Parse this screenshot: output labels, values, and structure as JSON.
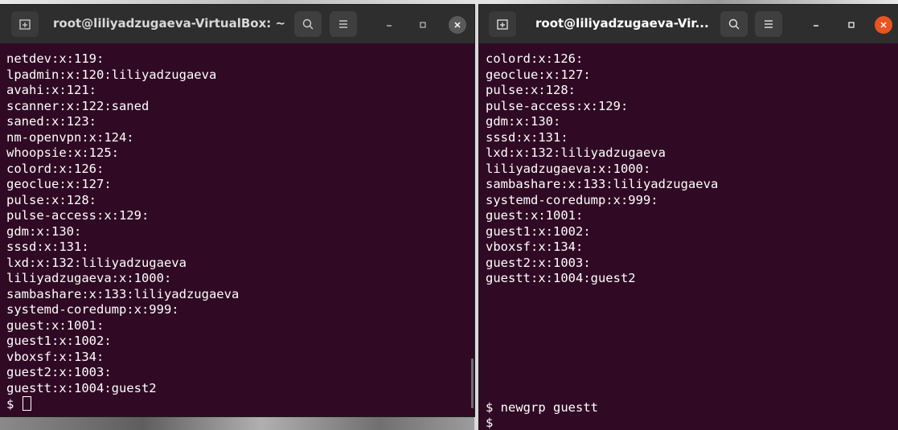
{
  "left_window": {
    "title": "root@liliyadzugaeva-VirtualBox: ~",
    "lines": [
      "netdev:x:119:",
      "lpadmin:x:120:liliyadzugaeva",
      "avahi:x:121:",
      "scanner:x:122:saned",
      "saned:x:123:",
      "nm-openvpn:x:124:",
      "whoopsie:x:125:",
      "colord:x:126:",
      "geoclue:x:127:",
      "pulse:x:128:",
      "pulse-access:x:129:",
      "gdm:x:130:",
      "sssd:x:131:",
      "lxd:x:132:liliyadzugaeva",
      "liliyadzugaeva:x:1000:",
      "sambashare:x:133:liliyadzugaeva",
      "systemd-coredump:x:999:",
      "guest:x:1001:",
      "guest1:x:1002:",
      "vboxsf:x:134:",
      "guest2:x:1003:",
      "guestt:x:1004:guest2"
    ],
    "prompt": "$ "
  },
  "right_window": {
    "title": "root@liliyadzugaeva-Vir...",
    "lines": [
      "colord:x:126:",
      "geoclue:x:127:",
      "pulse:x:128:",
      "pulse-access:x:129:",
      "gdm:x:130:",
      "sssd:x:131:",
      "lxd:x:132:liliyadzugaeva",
      "liliyadzugaeva:x:1000:",
      "sambashare:x:133:liliyadzugaeva",
      "systemd-coredump:x:999:",
      "guest:x:1001:",
      "guest1:x:1002:",
      "vboxsf:x:134:",
      "guest2:x:1003:",
      "guestt:x:1004:guest2"
    ],
    "command_line": "$ newgrp guestt",
    "prompt": "$"
  },
  "icons": {
    "new_tab": "new-tab-icon",
    "search": "search-icon",
    "menu": "hamburger-menu-icon",
    "minimize": "minimize-icon",
    "maximize": "maximize-icon",
    "close": "close-icon"
  },
  "colors": {
    "terminal_bg": "#300a24",
    "titlebar_bg": "#2e2e2e",
    "close_active": "#e95420",
    "close_inactive": "#5a5a5a",
    "text": "#ffffff"
  }
}
